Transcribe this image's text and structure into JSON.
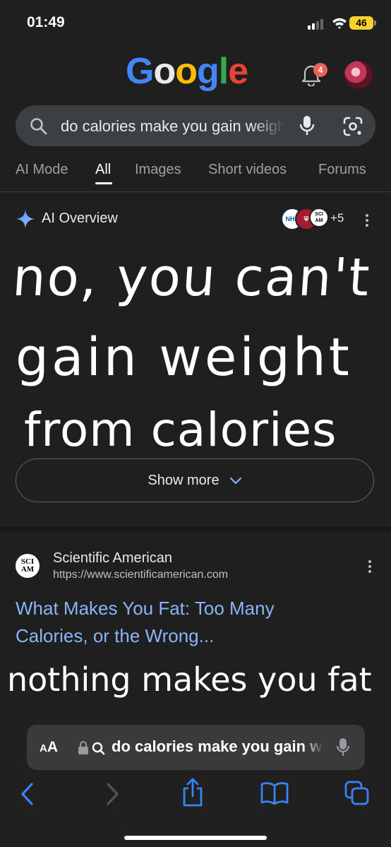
{
  "status": {
    "time": "01:49",
    "battery": "46"
  },
  "header": {
    "logo_text": "Google",
    "notification_count": "4"
  },
  "search": {
    "query": "do calories make you gain weight"
  },
  "tabs": [
    {
      "label": "AI Mode"
    },
    {
      "label": "All"
    },
    {
      "label": "Images"
    },
    {
      "label": "Short videos"
    },
    {
      "label": "Forums"
    }
  ],
  "ai_overview": {
    "title": "AI Overview",
    "sources": [
      "NHS",
      "",
      "SCI AM"
    ],
    "more_sources": "+5",
    "handwritten_lines": [
      "no, you can't",
      "gain weight",
      "from calories"
    ],
    "show_more_label": "Show more"
  },
  "result": {
    "favicon_text": "SCI AM",
    "site_name": "Scientific American",
    "url": "https://www.scientificamerican.com",
    "title": "What Makes You Fat: Too Many Calories, or the Wrong...",
    "handwritten_note": "nothing makes you fat"
  },
  "browser": {
    "text_size_label": "AA",
    "address": "do calories make you gain weight"
  },
  "colors": {
    "link": "#8ab4f8",
    "background": "#1f1f1f",
    "battery": "#f6d22b",
    "badge": "#e8615a"
  }
}
